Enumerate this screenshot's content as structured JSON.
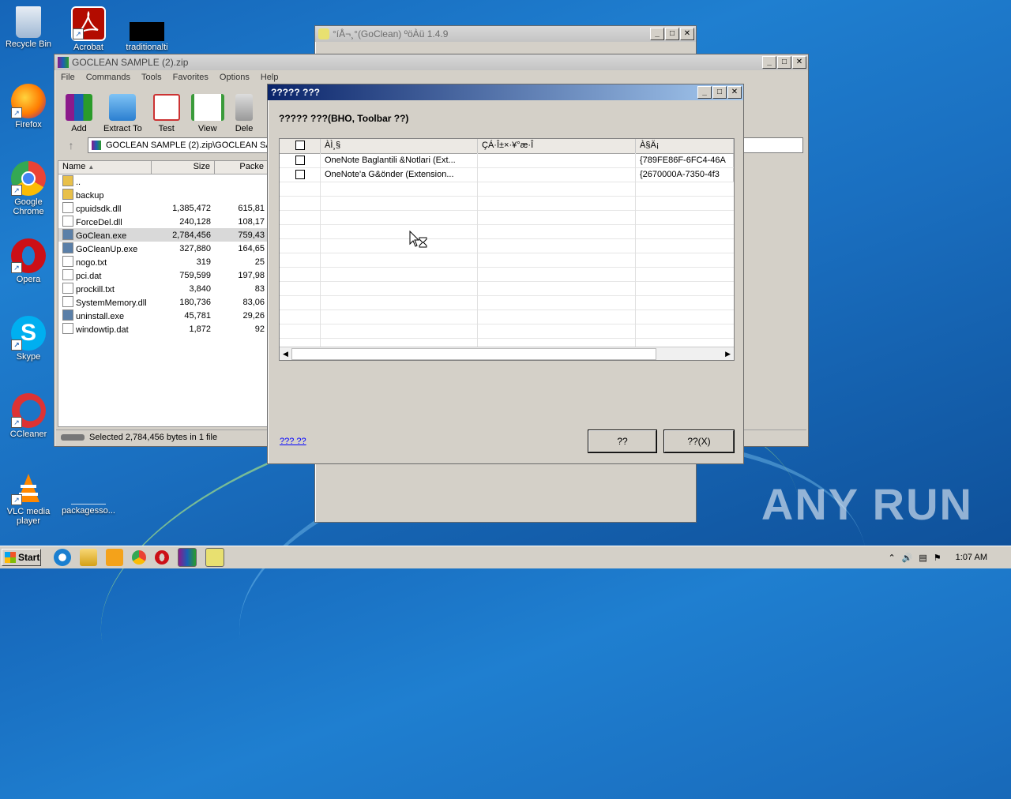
{
  "desktop": {
    "icons": [
      {
        "label": "Recycle Bin",
        "color": "#9fb8d4"
      },
      {
        "label": "Acrobat",
        "color": "#b30b00"
      },
      {
        "label": "traditionalti",
        "color": "#000000"
      },
      {
        "label": "Firefox",
        "color": "#ff7b00"
      },
      {
        "label": "Google Chrome",
        "color": "#34a853"
      },
      {
        "label": "Opera",
        "color": "#cc0f16"
      },
      {
        "label": "Skype",
        "color": "#00aff0"
      },
      {
        "label": "CCleaner",
        "color": "#d33"
      },
      {
        "label": "VLC media player",
        "color": "#ff8800"
      },
      {
        "label": "packagesso...",
        "color": "#1a6fc0"
      }
    ],
    "watermark": "ANY RUN"
  },
  "goclean_window": {
    "title": "°íÅ¬¸°(GoClean) ºöÀü 1.4.9"
  },
  "winrar": {
    "title": "GOCLEAN SAMPLE (2).zip",
    "menu": [
      "File",
      "Commands",
      "Tools",
      "Favorites",
      "Options",
      "Help"
    ],
    "tools": [
      "Add",
      "Extract To",
      "Test",
      "View",
      "Dele"
    ],
    "address": "GOCLEAN SAMPLE (2).zip\\GOCLEAN SAI",
    "columns": [
      "Name",
      "Size",
      "Packe"
    ],
    "files": [
      {
        "name": "..",
        "size": "",
        "packed": ""
      },
      {
        "name": "backup",
        "size": "",
        "packed": ""
      },
      {
        "name": "cpuidsdk.dll",
        "size": "1,385,472",
        "packed": "615,81"
      },
      {
        "name": "ForceDel.dll",
        "size": "240,128",
        "packed": "108,17"
      },
      {
        "name": "GoClean.exe",
        "size": "2,784,456",
        "packed": "759,43"
      },
      {
        "name": "GoCleanUp.exe",
        "size": "327,880",
        "packed": "164,65"
      },
      {
        "name": "nogo.txt",
        "size": "319",
        "packed": "25"
      },
      {
        "name": "pci.dat",
        "size": "759,599",
        "packed": "197,98"
      },
      {
        "name": "prockill.txt",
        "size": "3,840",
        "packed": "83"
      },
      {
        "name": "SystemMemory.dll",
        "size": "180,736",
        "packed": "83,06"
      },
      {
        "name": "uninstall.exe",
        "size": "45,781",
        "packed": "29,26"
      },
      {
        "name": "windowtip.dat",
        "size": "1,872",
        "packed": "92"
      }
    ],
    "status": "Selected 2,784,456 bytes in 1 file"
  },
  "dialog": {
    "title": "????? ???",
    "heading": "????? ???(BHO, Toolbar ??)",
    "columns": [
      "ÀÌ¸§",
      "ÇÁ·Î±×·¥°æ·Î",
      "À§Ä¡"
    ],
    "rows": [
      {
        "name": "OneNote Baglantili &Notlari (Ext...",
        "path": "",
        "loc": "{789FE86F-6FC4-46A"
      },
      {
        "name": "OneNote'a G&önder (Extension...",
        "path": "",
        "loc": "{2670000A-7350-4f3"
      }
    ],
    "link": "??? ??",
    "btn_ok": "??",
    "btn_close": "??(X)"
  },
  "taskbar": {
    "start": "Start",
    "time": "1:07 AM"
  }
}
